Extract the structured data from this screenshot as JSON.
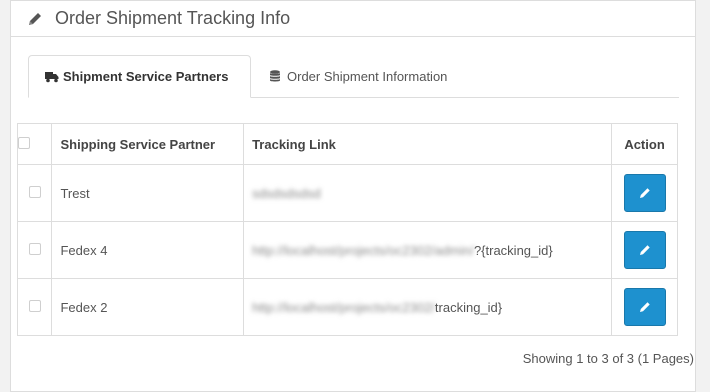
{
  "panel": {
    "title": "Order Shipment Tracking Info",
    "title_icon": "pencil-icon"
  },
  "tabs": [
    {
      "label": "Shipment Service Partners",
      "icon": "truck-icon",
      "active": true
    },
    {
      "label": "Order Shipment Information",
      "icon": "database-icon",
      "active": false
    }
  ],
  "table": {
    "headers": {
      "partner": "Shipping Service Partner",
      "link": "Tracking Link",
      "action": "Action"
    },
    "rows": [
      {
        "partner": "Trest",
        "link_hidden": "sdsdsdsdsd",
        "link_visible": ""
      },
      {
        "partner": "Fedex 4",
        "link_hidden": "http://localhost/projects/oc2302/admin/",
        "link_visible": "?{tracking_id}"
      },
      {
        "partner": "Fedex 2",
        "link_hidden": "http://localhost/projects/oc2302/",
        "link_visible": "tracking_id}"
      }
    ]
  },
  "pagination": {
    "summary": "Showing 1 to 3 of 3 (1 Pages)"
  },
  "colors": {
    "primary_button": "#1e91cf",
    "border": "#dddddd",
    "text": "#555555"
  }
}
